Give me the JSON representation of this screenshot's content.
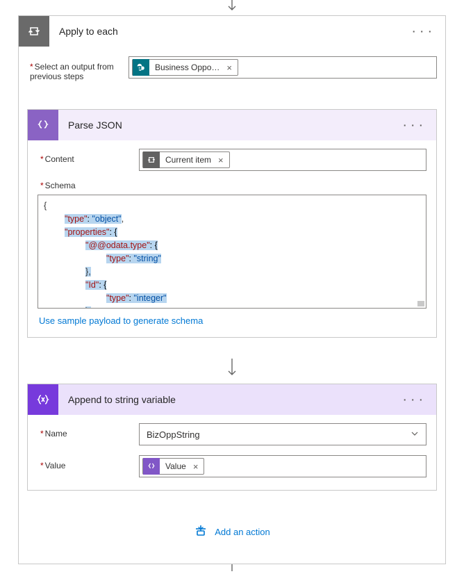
{
  "outer": {
    "title": "Apply to each",
    "menu": "· · ·",
    "selectOutputLabel": "Select an output from previous steps",
    "tokenBusiness": "Business Oppo…",
    "x": "×"
  },
  "parse": {
    "title": "Parse JSON",
    "menu": "· · ·",
    "contentLabel": "Content",
    "tokenCurrent": "Current item",
    "x": "×",
    "schemaLabel": "Schema",
    "link": "Use sample payload to generate schema"
  },
  "append": {
    "title": "Append to string variable",
    "menu": "· · ·",
    "nameLabel": "Name",
    "nameValue": "BizOppString",
    "valueLabel": "Value",
    "tokenValue": "Value",
    "x": "×"
  },
  "addAction": "Add an action",
  "schema": {
    "l1": "{",
    "l2a": "\"type\"",
    "l2b": ": ",
    "l2c": "\"object\"",
    "l2d": ",",
    "l3a": "\"properties\"",
    "l3b": ": {",
    "l4a": "\"@@odata.type\"",
    "l4b": ": {",
    "l5a": "\"type\"",
    "l5b": ": ",
    "l5c": "\"string\"",
    "l6": "},",
    "l7a": "\"Id\"",
    "l7b": ": {",
    "l8a": "\"type\"",
    "l8b": ": ",
    "l8c": "\"integer\"",
    "l9": "},"
  }
}
